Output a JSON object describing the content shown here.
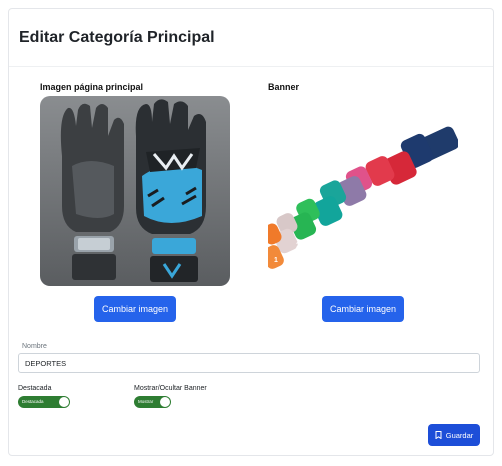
{
  "header": {
    "title": "Editar Categoría Principal"
  },
  "main_image": {
    "label": "Imagen página principal",
    "button_label": "Cambiar imagen"
  },
  "banner_image": {
    "label": "Banner",
    "button_label": "Cambiar imagen"
  },
  "nombre": {
    "label": "Nombre",
    "value": "DEPORTES"
  },
  "toggles": [
    {
      "label": "Destacada",
      "inner_text": "Destacada",
      "on": true
    },
    {
      "label": "Mostrar/Ocultar Banner",
      "inner_text": "Mostrar",
      "on": true
    }
  ],
  "save": {
    "label": "Guardar",
    "icon": "bookmark-icon"
  },
  "colors": {
    "primary": "#2563eb",
    "toggle_on": "#2e7d32"
  }
}
